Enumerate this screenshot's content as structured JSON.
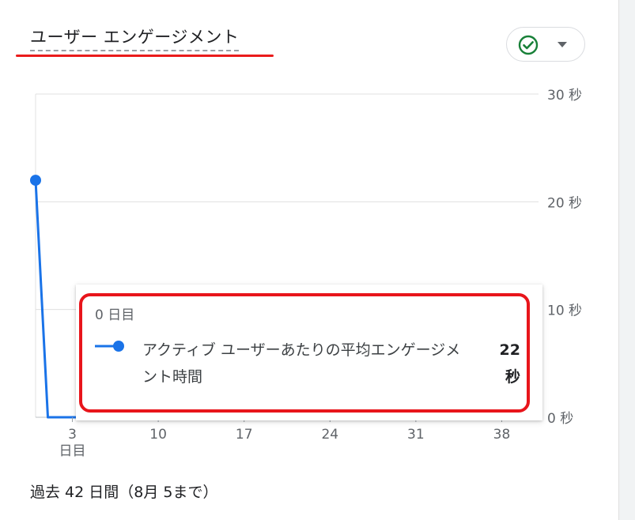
{
  "card": {
    "title": "ユーザー エンゲージメント",
    "status_icon": "check-circle-icon",
    "dropdown_icon": "caret-down-icon",
    "footer": "過去 42 日間（8月 5まで）"
  },
  "colors": {
    "series": "#1a73e8",
    "status_ok": "#188038",
    "annotation": "#e8151b",
    "grid": "#e0e0e0"
  },
  "tooltip": {
    "date": "0 日目",
    "metric": "アクティブ ユーザーあたりの平均エンゲージメント時間",
    "value": "22 秒"
  },
  "chart_data": {
    "type": "line",
    "title": "ユーザー エンゲージメント",
    "xlabel": "",
    "ylabel": "",
    "x_unit": "日目",
    "y_unit": "秒",
    "x_ticks": [
      {
        "value": 3,
        "label": "3"
      },
      {
        "value": 10,
        "label": "10"
      },
      {
        "value": 17,
        "label": "17"
      },
      {
        "value": 24,
        "label": "24"
      },
      {
        "value": 31,
        "label": "31"
      },
      {
        "value": 38,
        "label": "38"
      }
    ],
    "y_ticks": [
      {
        "value": 0,
        "label": "0 秒"
      },
      {
        "value": 10,
        "label": "10 秒"
      },
      {
        "value": 20,
        "label": "20 秒"
      },
      {
        "value": 30,
        "label": "30 秒"
      }
    ],
    "xlim": [
      0,
      41
    ],
    "ylim": [
      0,
      30
    ],
    "y_axis_position": "right",
    "grid": true,
    "series": [
      {
        "name": "アクティブ ユーザーあたりの平均エンゲージメント時間",
        "x": [
          0,
          1,
          2,
          3,
          4,
          5,
          6,
          7,
          8,
          9,
          10,
          11,
          12,
          13,
          14,
          15,
          16,
          17,
          18,
          19,
          20,
          21,
          22,
          23,
          24,
          25,
          26,
          27,
          28,
          29,
          30,
          31,
          32,
          33,
          34,
          35,
          36,
          37,
          38,
          39,
          40,
          41
        ],
        "values": [
          22,
          0,
          0,
          0,
          0,
          0,
          0,
          0,
          0,
          0,
          0,
          0,
          0,
          0,
          0,
          0,
          0,
          0,
          0,
          0,
          0,
          0,
          0,
          0,
          0,
          0,
          0,
          0,
          0,
          0,
          0,
          0,
          0,
          0,
          0,
          0,
          0,
          0,
          0,
          0,
          0,
          0
        ]
      }
    ],
    "highlighted_point": {
      "x": 0,
      "y": 22
    }
  }
}
